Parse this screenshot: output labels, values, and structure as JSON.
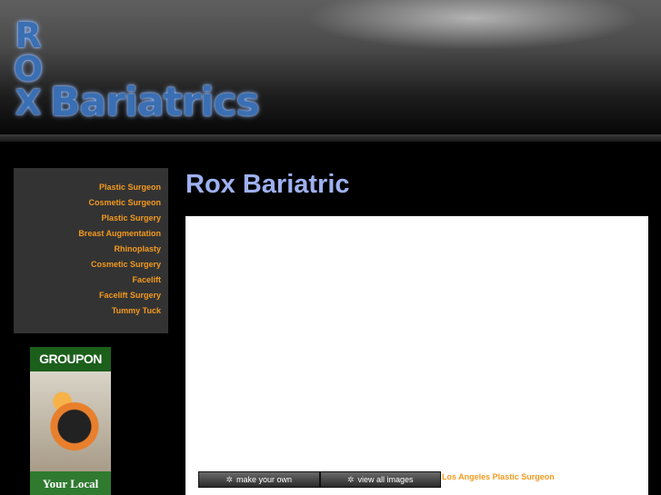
{
  "header": {
    "logo_letters": [
      "R",
      "O",
      "X"
    ],
    "logo_word": "Bariatrics"
  },
  "sidebar": {
    "nav": [
      {
        "label": "Plastic Surgeon"
      },
      {
        "label": "Cosmetic Surgeon"
      },
      {
        "label": "Plastic Surgery"
      },
      {
        "label": "Breast Augmentation"
      },
      {
        "label": "Rhinoplasty"
      },
      {
        "label": "Cosmetic Surgery"
      },
      {
        "label": "Facelift"
      },
      {
        "label": "Facelift Surgery"
      },
      {
        "label": "Tummy Tuck"
      }
    ]
  },
  "ad": {
    "brand": "GROUPON",
    "caption": "Your Local"
  },
  "main": {
    "title": "Rox Bariatric",
    "toolbar": {
      "make_your_own": "make your own",
      "view_all_images": "view all images",
      "icon": "sparkle-icon"
    },
    "footer_link": "Los Angeles Plastic Surgeon"
  },
  "colors": {
    "accent_orange": "#f39a1f",
    "title_lavender": "#9db0f0",
    "logo_blue": "#3a6fb3",
    "sidebar_bg": "#333333"
  }
}
